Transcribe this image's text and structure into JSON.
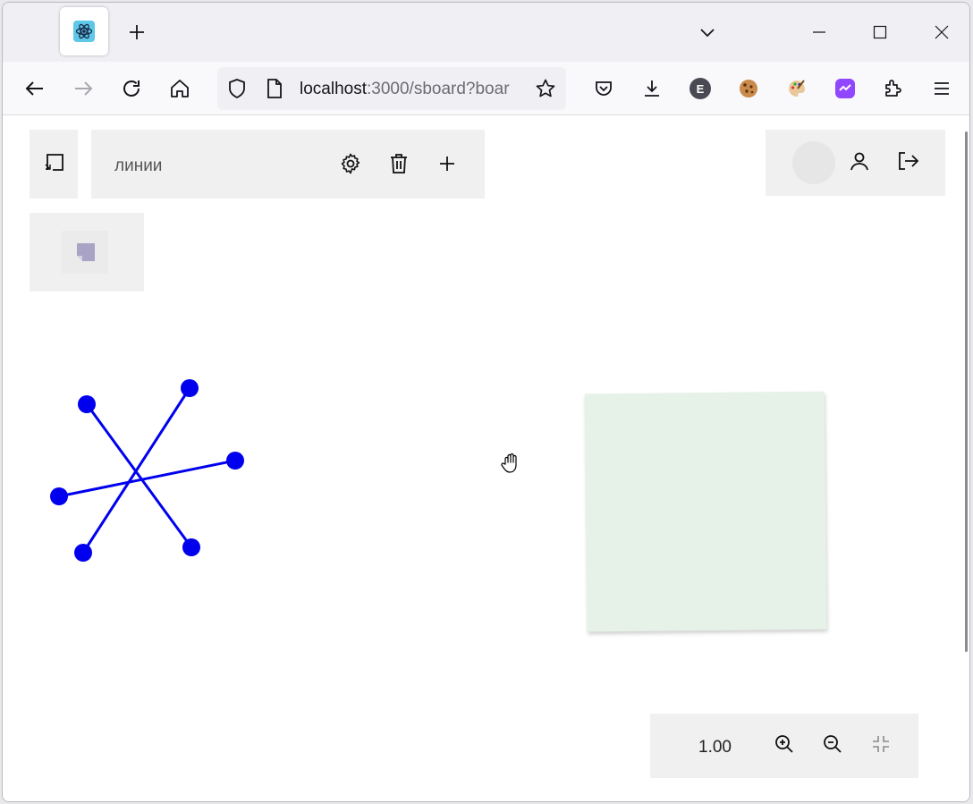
{
  "browser": {
    "tab_icon": "react-atom-icon",
    "new_tab_icon": "plus-icon",
    "tab_list_icon": "chevron-down-icon",
    "window_controls": [
      "minimize-icon",
      "maximize-icon",
      "close-icon"
    ],
    "url_host": "localhost",
    "url_rest": ":3000/sboard?boar",
    "extensions": [
      {
        "name": "pocket-icon"
      },
      {
        "name": "download-icon"
      },
      {
        "name": "ext-e-icon",
        "label": "E",
        "color": "#4a4a55"
      },
      {
        "name": "cookie-icon"
      },
      {
        "name": "palette-icon"
      },
      {
        "name": "purple-ext-icon",
        "color": "#9146ff"
      },
      {
        "name": "extensions-puzzle-icon"
      },
      {
        "name": "menu-icon"
      }
    ]
  },
  "toolbar": {
    "board_title": "линии"
  },
  "zoom": {
    "value": "1.00"
  },
  "colors": {
    "line": "#0000ee",
    "sticky": "#e6f2e8",
    "panel": "#f0f0f0"
  }
}
